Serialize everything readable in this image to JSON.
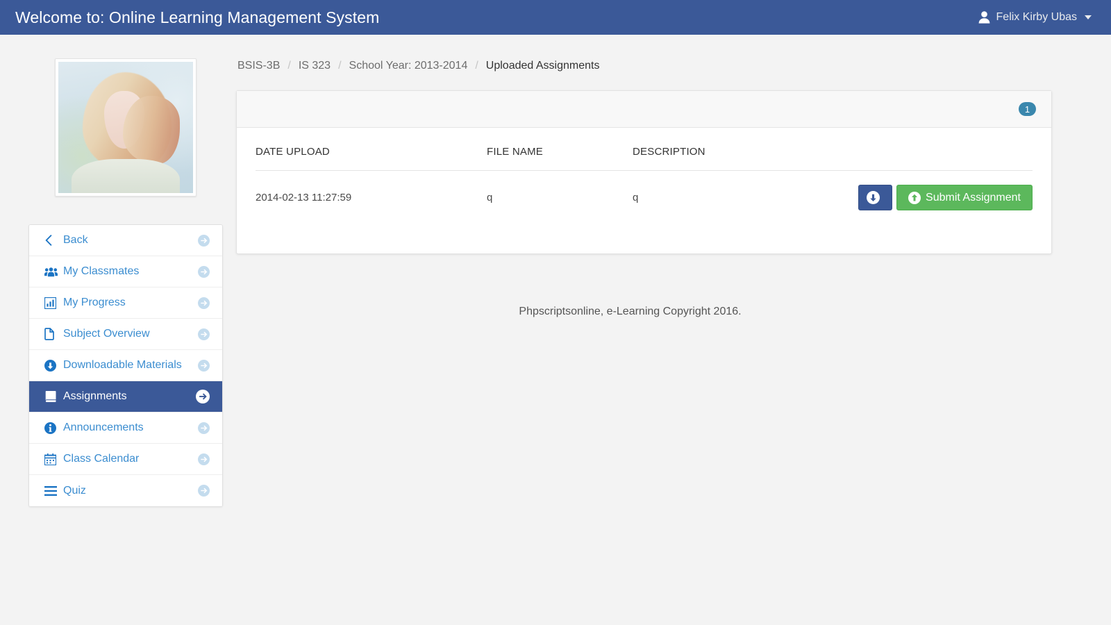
{
  "navbar": {
    "title": "Welcome to: Online Learning Management System",
    "user_name": "Felix Kirby Ubas",
    "user_icon": "user-icon",
    "caret_icon": "caret-down-icon",
    "background_color": "#3b5998"
  },
  "profile": {
    "avatar_alt": "student-profile-photo"
  },
  "sidebar": {
    "items": [
      {
        "label": "Back",
        "icon": "chevron-left-icon",
        "active": false
      },
      {
        "label": "My Classmates",
        "icon": "users-icon",
        "active": false
      },
      {
        "label": "My Progress",
        "icon": "bar-chart-icon",
        "active": false
      },
      {
        "label": "Subject Overview",
        "icon": "file-icon",
        "active": false
      },
      {
        "label": "Downloadable Materials",
        "icon": "download-circle-icon",
        "active": false
      },
      {
        "label": "Assignments",
        "icon": "book-icon",
        "active": true
      },
      {
        "label": "Announcements",
        "icon": "info-circle-icon",
        "active": false
      },
      {
        "label": "Class Calendar",
        "icon": "calendar-icon",
        "active": false
      },
      {
        "label": "Quiz",
        "icon": "list-icon",
        "active": false
      }
    ],
    "arrow_icon": "arrow-circle-right-icon",
    "active_color": "#3b5998",
    "link_color": "#3b8dd0"
  },
  "breadcrumb": {
    "items": [
      {
        "label": "BSIS-3B",
        "current": false
      },
      {
        "label": "IS 323",
        "current": false
      },
      {
        "label": "School Year: 2013-2014",
        "current": false
      },
      {
        "label": "Uploaded Assignments",
        "current": true
      }
    ],
    "separator": "/"
  },
  "panel": {
    "badge_count": "1",
    "badge_color": "#3a87ad",
    "table": {
      "columns": [
        "DATE UPLOAD",
        "FILE NAME",
        "DESCRIPTION",
        ""
      ],
      "rows": [
        {
          "date_upload": "2014-02-13 11:27:59",
          "file_name": "q",
          "description": "q",
          "download_label": "",
          "download_icon": "download-circle-icon",
          "submit_label": "Submit Assignment",
          "submit_icon": "upload-circle-icon"
        }
      ]
    },
    "download_button_color": "#3b5998",
    "submit_button_color": "#5cb85c"
  },
  "footer": {
    "text": "Phpscriptsonline, e-Learning Copyright 2016."
  }
}
